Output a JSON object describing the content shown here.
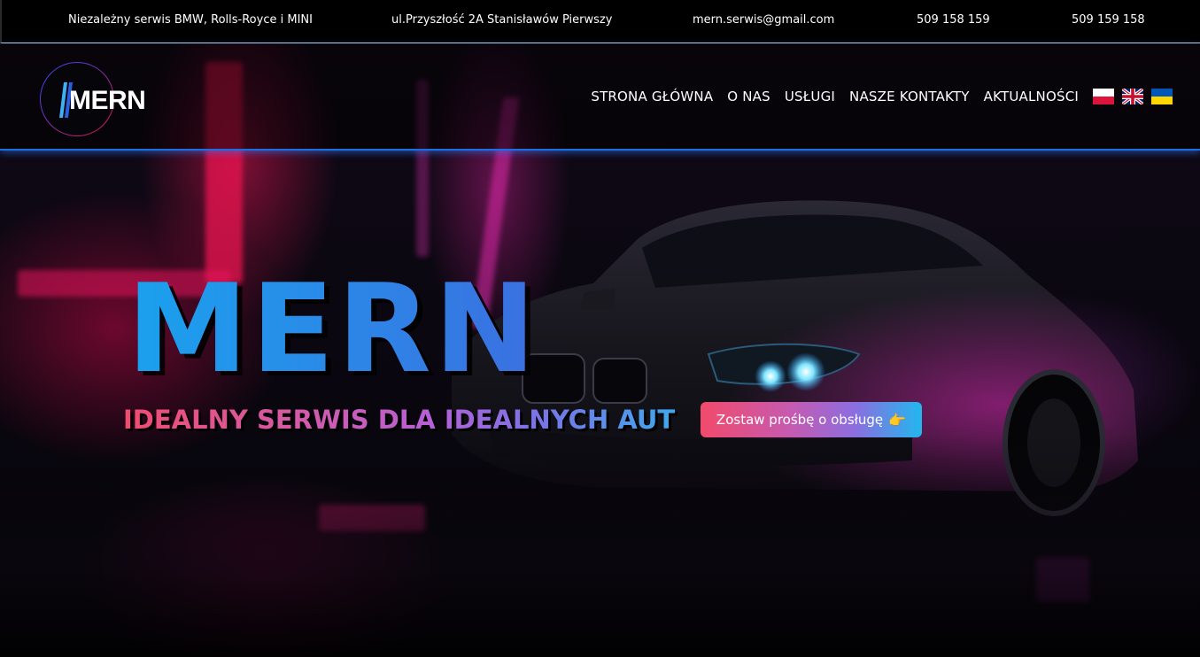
{
  "topbar": {
    "tagline": "Niezależny serwis BMW, Rolls-Royce i MINI",
    "address": "ul.Przyszłość 2A Stanisławów Pierwszy",
    "email": "mern.serwis@gmail.com",
    "phone_1": "509 158 159",
    "phone_2": "509 159 158"
  },
  "logo": {
    "text": "MERN"
  },
  "nav": {
    "items": [
      {
        "label": "STRONA GŁÓWNA"
      },
      {
        "label": "O NAS"
      },
      {
        "label": "USŁUGI"
      },
      {
        "label": "NASZE KONTAKTY"
      },
      {
        "label": "AKTUALNOŚCI"
      }
    ],
    "languages": [
      {
        "icon": "flag-pl-icon"
      },
      {
        "icon": "flag-gb-icon"
      },
      {
        "icon": "flag-ua-icon"
      }
    ]
  },
  "hero": {
    "title": "MERN",
    "subtitle": "IDEALNY SERWIS DLA IDEALNYCH AUT",
    "cta_label": "Zostaw prośbę o obsługę",
    "cta_icon": "👉"
  },
  "colors": {
    "accent_blue": "#1f9be8",
    "navbar_border": "#1d6fe0",
    "gradient_pink": "#f24a6b",
    "gradient_cyan": "#22b7ee"
  }
}
